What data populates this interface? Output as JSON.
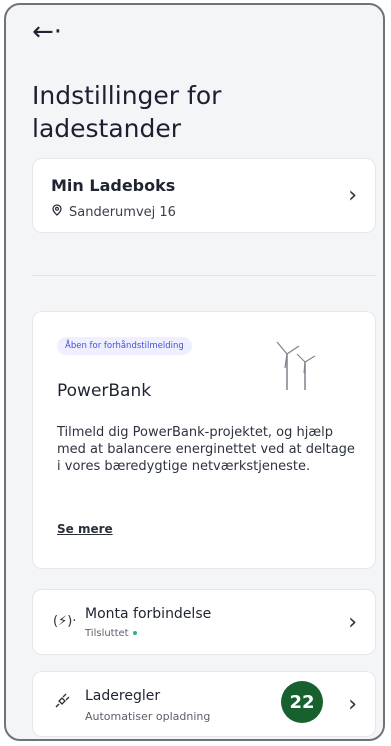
{
  "header": {
    "back_label": "←·"
  },
  "page": {
    "title": "Indstillinger for ladestander"
  },
  "charger": {
    "name": "Min Ladeboks",
    "address": "Sanderumvej 16",
    "pin_icon": "location-pin-icon"
  },
  "powerbank": {
    "badge": "Åben for forhåndstilmelding",
    "title": "PowerBank",
    "description": "Tilmeld dig PowerBank-projektet, og hjælp med at balancere energinettet ved at deltage i vores bæredygtige netværkstjeneste.",
    "link": "Se mere",
    "illustration_icon": "wind-turbine-icon"
  },
  "connection": {
    "icon": "connection-icon",
    "icon_text": "(⚡)·",
    "title": "Monta forbindelse",
    "status": "Tilsluttet",
    "status_color": "#2bb673"
  },
  "rules": {
    "icon": "plug-icon",
    "title": "Laderegler",
    "subtitle": "Automatiser opladning"
  },
  "overlay": {
    "number": "22"
  }
}
